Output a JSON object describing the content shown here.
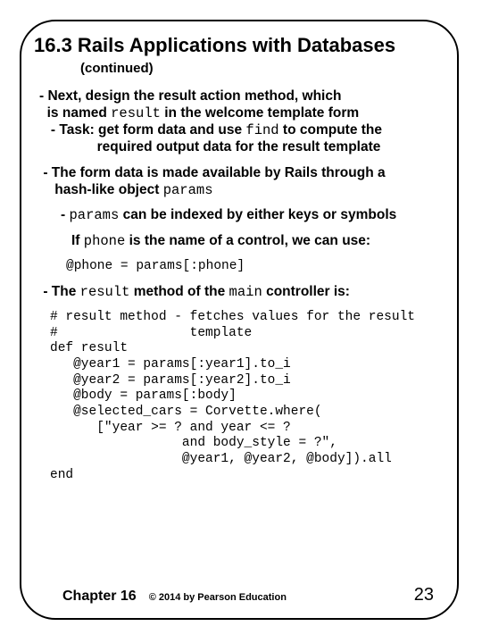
{
  "title": "16.3 Rails Applications with Databases",
  "continued": "(continued)",
  "p1a": "- Next, design the result action method, which",
  "p1b": "is named ",
  "p1b_code": "result",
  "p1b_end": " in the welcome template form",
  "p1c": "- Task: get form data and use ",
  "p1c_code": "find",
  "p1c_end": " to compute the",
  "p1d": "required output data for the result template",
  "p2a": "- The form data is made available by Rails through a",
  "p2b": "hash-like object ",
  "p2b_code": "params",
  "p3a": "- ",
  "p3a_code": "params",
  "p3a_end": " can be indexed by either keys or symbols",
  "p4a": "If ",
  "p4a_code": "phone",
  "p4a_end": " is the name of a control, we can use:",
  "code1": "@phone = params[:phone]",
  "p5a": "- The ",
  "p5a_code": "result",
  "p5a_mid": " method of the ",
  "p5a_code2": "main",
  "p5a_end": " controller is:",
  "code2": "# result method - fetches values for the result\n#                 template\ndef result\n   @year1 = params[:year1].to_i\n   @year2 = params[:year2].to_i\n   @body = params[:body]\n   @selected_cars = Corvette.where(\n      [\"year >= ? and year <= ?\n                 and body_style = ?\",\n                 @year1, @year2, @body]).all\nend",
  "footer": {
    "chapter": "Chapter 16",
    "copyright": "© 2014 by Pearson Education",
    "page": "23"
  }
}
